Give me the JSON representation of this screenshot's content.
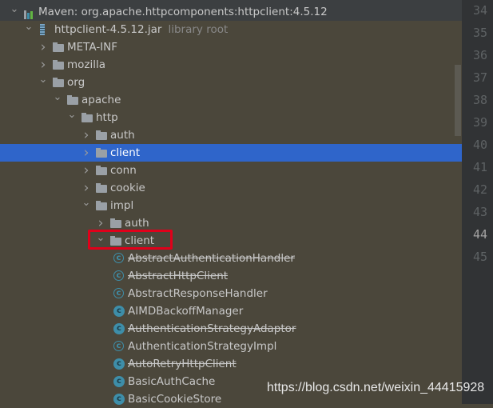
{
  "tree": [
    {
      "label": "Maven: org.apache.httpcomponents:httpclient:4.5.12",
      "depth": 0,
      "state": "open",
      "icon": "maven-library-icon"
    },
    {
      "label": "httpclient-4.5.12.jar",
      "hint": "library root",
      "depth": 1,
      "state": "open",
      "icon": "jar-icon"
    },
    {
      "label": "META-INF",
      "depth": 2,
      "state": "closed",
      "icon": "folder-icon"
    },
    {
      "label": "mozilla",
      "depth": 2,
      "state": "closed",
      "icon": "folder-icon"
    },
    {
      "label": "org",
      "depth": 2,
      "state": "open",
      "icon": "folder-icon"
    },
    {
      "label": "apache",
      "depth": 3,
      "state": "open",
      "icon": "folder-icon"
    },
    {
      "label": "http",
      "depth": 4,
      "state": "open",
      "icon": "folder-icon"
    },
    {
      "label": "auth",
      "depth": 5,
      "state": "closed",
      "icon": "folder-icon"
    },
    {
      "label": "client",
      "depth": 5,
      "state": "closed",
      "icon": "folder-icon",
      "selected": true
    },
    {
      "label": "conn",
      "depth": 5,
      "state": "closed",
      "icon": "folder-icon"
    },
    {
      "label": "cookie",
      "depth": 5,
      "state": "closed",
      "icon": "folder-icon"
    },
    {
      "label": "impl",
      "depth": 5,
      "state": "open",
      "icon": "folder-icon"
    },
    {
      "label": "auth",
      "depth": 6,
      "state": "closed",
      "icon": "folder-icon"
    },
    {
      "label": "client",
      "depth": 6,
      "state": "open",
      "icon": "folder-icon",
      "highlighted": true
    },
    {
      "label": "AbstractAuthenticationHandler",
      "depth": 7,
      "icon": "abstract-class-icon",
      "deprecated": true
    },
    {
      "label": "AbstractHttpClient",
      "depth": 7,
      "icon": "abstract-class-icon",
      "deprecated": true
    },
    {
      "label": "AbstractResponseHandler",
      "depth": 7,
      "icon": "abstract-class-icon"
    },
    {
      "label": "AIMDBackoffManager",
      "depth": 7,
      "icon": "class-icon"
    },
    {
      "label": "AuthenticationStrategyAdaptor",
      "depth": 7,
      "icon": "class-icon",
      "deprecated": true
    },
    {
      "label": "AuthenticationStrategyImpl",
      "depth": 7,
      "icon": "abstract-class-icon"
    },
    {
      "label": "AutoRetryHttpClient",
      "depth": 7,
      "icon": "class-icon",
      "deprecated": true
    },
    {
      "label": "BasicAuthCache",
      "depth": 7,
      "icon": "class-icon"
    },
    {
      "label": "BasicCookieStore",
      "depth": 7,
      "icon": "class-icon"
    }
  ],
  "gutter": {
    "lines": [
      "34",
      "35",
      "36",
      "37",
      "38",
      "39",
      "40",
      "41",
      "42",
      "43",
      "44",
      "45"
    ],
    "current": "44"
  },
  "watermark": "https://blog.csdn.net/weixin_44415928",
  "colors": {
    "selection": "#2f65ca",
    "highlight_box": "#e0001a",
    "background": "#4b473b"
  }
}
